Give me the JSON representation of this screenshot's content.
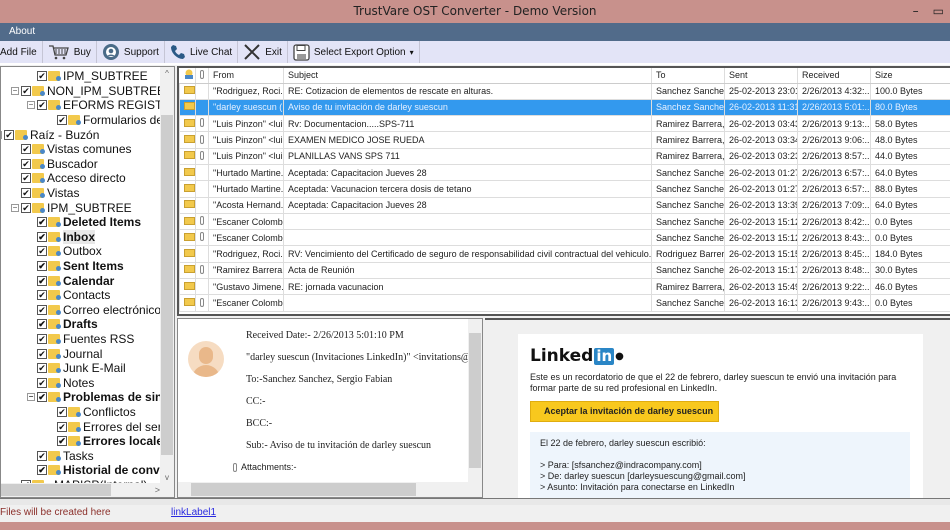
{
  "window": {
    "title": "TrustVare OST Converter - Demo Version",
    "minimize": "–",
    "maximize": "▭"
  },
  "menu": {
    "about": "About"
  },
  "toolbar": [
    {
      "label": "Add File",
      "icon": "add-file-icon"
    },
    {
      "label": "Buy",
      "icon": "cart-icon"
    },
    {
      "label": "Support",
      "icon": "support-icon"
    },
    {
      "label": "Live Chat",
      "icon": "phone-icon"
    },
    {
      "label": "Exit",
      "icon": "close-icon"
    },
    {
      "label": "Select Export Option",
      "icon": "save-icon",
      "dropdown": "▾"
    }
  ],
  "tree": [
    {
      "label": "IPM_SUBTREE",
      "level": 2,
      "bold": false
    },
    {
      "label": "NON_IPM_SUBTREE",
      "level": 1,
      "bold": false,
      "expander": "−"
    },
    {
      "label": "EFORMS REGISTRY",
      "level": 2,
      "bold": false,
      "expander": "−"
    },
    {
      "label": "Formularios de organización",
      "level": 3,
      "bold": false
    },
    {
      "label": "Raíz - Buzón",
      "level": 0,
      "bold": false,
      "expander": "−"
    },
    {
      "label": "Vistas comunes",
      "level": 1,
      "bold": false
    },
    {
      "label": "Buscador",
      "level": 1,
      "bold": false
    },
    {
      "label": "Acceso directo",
      "level": 1,
      "bold": false
    },
    {
      "label": "Vistas",
      "level": 1,
      "bold": false
    },
    {
      "label": "IPM_SUBTREE",
      "level": 1,
      "bold": false,
      "expander": "−"
    },
    {
      "label": "Deleted Items",
      "level": 2,
      "bold": true
    },
    {
      "label": "Inbox",
      "level": 2,
      "bold": true,
      "selected": true
    },
    {
      "label": "Outbox",
      "level": 2,
      "bold": false
    },
    {
      "label": "Sent Items",
      "level": 2,
      "bold": true
    },
    {
      "label": "Calendar",
      "level": 2,
      "bold": true
    },
    {
      "label": "Contacts",
      "level": 2,
      "bold": false
    },
    {
      "label": "Correo electrónico no deseado",
      "level": 2,
      "bold": false
    },
    {
      "label": "Drafts",
      "level": 2,
      "bold": true
    },
    {
      "label": "Fuentes RSS",
      "level": 2,
      "bold": false
    },
    {
      "label": "Journal",
      "level": 2,
      "bold": false
    },
    {
      "label": "Junk E-Mail",
      "level": 2,
      "bold": false
    },
    {
      "label": "Notes",
      "level": 2,
      "bold": false
    },
    {
      "label": "Problemas de sincronización",
      "level": 2,
      "bold": true,
      "expander": "−"
    },
    {
      "label": "Conflictos",
      "level": 3,
      "bold": false
    },
    {
      "label": "Errores del servidor",
      "level": 3,
      "bold": false
    },
    {
      "label": "Errores locales",
      "level": 3,
      "bold": true
    },
    {
      "label": "Tasks",
      "level": 2,
      "bold": false
    },
    {
      "label": "Historial de conversaciones",
      "level": 2,
      "bold": true
    },
    {
      "label": "~MAPISP(Internal)",
      "level": 1,
      "bold": false
    }
  ],
  "grid": {
    "columns": [
      "",
      "",
      "From",
      "Subject",
      "To",
      "Sent",
      "Received",
      "Size"
    ],
    "rows": [
      {
        "attach": false,
        "from": "\"Rodriguez, Roci...",
        "subject": "RE: Cotizacion de elementos de rescate en alturas.",
        "to": "Sanchez Sanche...",
        "sent": "25-02-2013 23:01",
        "received": "2/26/2013 4:32:...",
        "size": "100.0 Bytes"
      },
      {
        "attach": false,
        "from": "\"darley suescun (...",
        "subject": "Aviso de tu invitación de darley suescun",
        "to": "Sanchez Sanche...",
        "sent": "26-02-2013 11:31",
        "received": "2/26/2013 5:01:...",
        "size": "80.0 Bytes",
        "selected": true
      },
      {
        "attach": true,
        "from": "\"Luis Pinzon\" <lui...",
        "subject": "Rv: Documentacion.....SPS-711",
        "to": "Ramirez Barrera, ...",
        "sent": "26-02-2013 03:43",
        "received": "2/26/2013 9:13:...",
        "size": "58.0 Bytes"
      },
      {
        "attach": true,
        "from": "\"Luis Pinzon\" <lui...",
        "subject": "EXAMEN MEDICO JOSE RUEDA",
        "to": "Ramirez Barrera, ...",
        "sent": "26-02-2013 03:34",
        "received": "2/26/2013 9:06:...",
        "size": "48.0 Bytes"
      },
      {
        "attach": true,
        "from": "\"Luis Pinzon\" <lui...",
        "subject": "PLANILLAS VANS SPS 711",
        "to": "Ramirez Barrera, ...",
        "sent": "26-02-2013 03:23",
        "received": "2/26/2013 8:57:...",
        "size": "44.0 Bytes"
      },
      {
        "attach": false,
        "from": "\"Hurtado Martine...",
        "subject": "Aceptada: Capacitacion Jueves 28",
        "to": "Sanchez Sanche...",
        "sent": "26-02-2013 01:27",
        "received": "2/26/2013 6:57:...",
        "size": "64.0 Bytes"
      },
      {
        "attach": false,
        "from": "\"Hurtado Martine...",
        "subject": "Aceptada: Vacunacion tercera dosis de tetano",
        "to": "Sanchez Sanche...",
        "sent": "26-02-2013 01:27",
        "received": "2/26/2013 6:57:...",
        "size": "88.0 Bytes"
      },
      {
        "attach": false,
        "from": "\"Acosta Hernand...",
        "subject": "Aceptada: Capacitacion Jueves 28",
        "to": "Sanchez Sanche...",
        "sent": "26-02-2013 13:39",
        "received": "2/26/2013 7:09:...",
        "size": "64.0 Bytes"
      },
      {
        "attach": true,
        "from": "\"Escaner Colomb...",
        "subject": "",
        "to": "Sanchez Sanche...",
        "sent": "26-02-2013 15:12",
        "received": "2/26/2013 8:42:...",
        "size": "0.0 Bytes"
      },
      {
        "attach": true,
        "from": "\"Escaner Colomb...",
        "subject": "",
        "to": "Sanchez Sanche...",
        "sent": "26-02-2013 15:12",
        "received": "2/26/2013 8:43:...",
        "size": "0.0 Bytes"
      },
      {
        "attach": false,
        "from": "\"Rodriguez, Roci...",
        "subject": "RV: Vencimiento del Certificado de seguro de responsabilidad civil contractual del vehiculo.",
        "to": "Rodriguez Barrer...",
        "sent": "26-02-2013 15:15",
        "received": "2/26/2013 8:45:...",
        "size": "184.0 Bytes"
      },
      {
        "attach": true,
        "from": "\"Ramirez Barrera,...",
        "subject": "Acta de Reunión",
        "to": "Sanchez Sanche...",
        "sent": "26-02-2013 15:17",
        "received": "2/26/2013 8:48:...",
        "size": "30.0 Bytes"
      },
      {
        "attach": false,
        "from": "\"Gustavo Jimene...",
        "subject": "RE: jornada vacunacion",
        "to": "Ramirez Barrera, ...",
        "sent": "26-02-2013 15:49",
        "received": "2/26/2013 9:22:...",
        "size": "46.0 Bytes"
      },
      {
        "attach": true,
        "from": "\"Escaner Colomb...",
        "subject": "",
        "to": "Sanchez Sanche...",
        "sent": "26-02-2013 16:13",
        "received": "2/26/2013 9:43:...",
        "size": "0.0 Bytes"
      }
    ]
  },
  "preview": {
    "received": "Received Date:- 2/26/2013 5:01:10 PM",
    "from": "\"darley suescun (Invitaciones LinkedIn)\" <invitations@linkedin.com>",
    "to": "To:-Sanchez Sanchez, Sergio Fabian",
    "cc": "CC:-",
    "bcc": "BCC:-",
    "subject": "Sub:- Aviso de tu invitación de darley suescun",
    "attachments": "Attachments:-"
  },
  "email_body": {
    "logo_text": "Linked",
    "logo_in": "in",
    "logo_dot": "●",
    "intro": "Este es un recordatorio de que el 22 de febrero, darley suescun te envió una invitación para formar parte de su red profesional en LinkedIn.",
    "button": "Aceptar la invitación de darley suescun",
    "quote_line1": "El 22 de febrero, darley suescun escribió:",
    "quote_para": "> Para: [sfsanchez@indracompany.com]",
    "quote_de": "> De: darley suescun [darleysuescung@gmail.com]",
    "quote_asunto": "> Asunto: Invitación para conectarse en LinkedIn"
  },
  "status": {
    "text": "Files will be created here",
    "link": "linkLabel1"
  },
  "colors": {
    "titlebar": "#c8918c",
    "menubar": "#516b8a",
    "toolbar": "#e3e4f7",
    "selection": "#3399ee",
    "linkedin": "#2a86c6",
    "button": "#f8c81e"
  }
}
